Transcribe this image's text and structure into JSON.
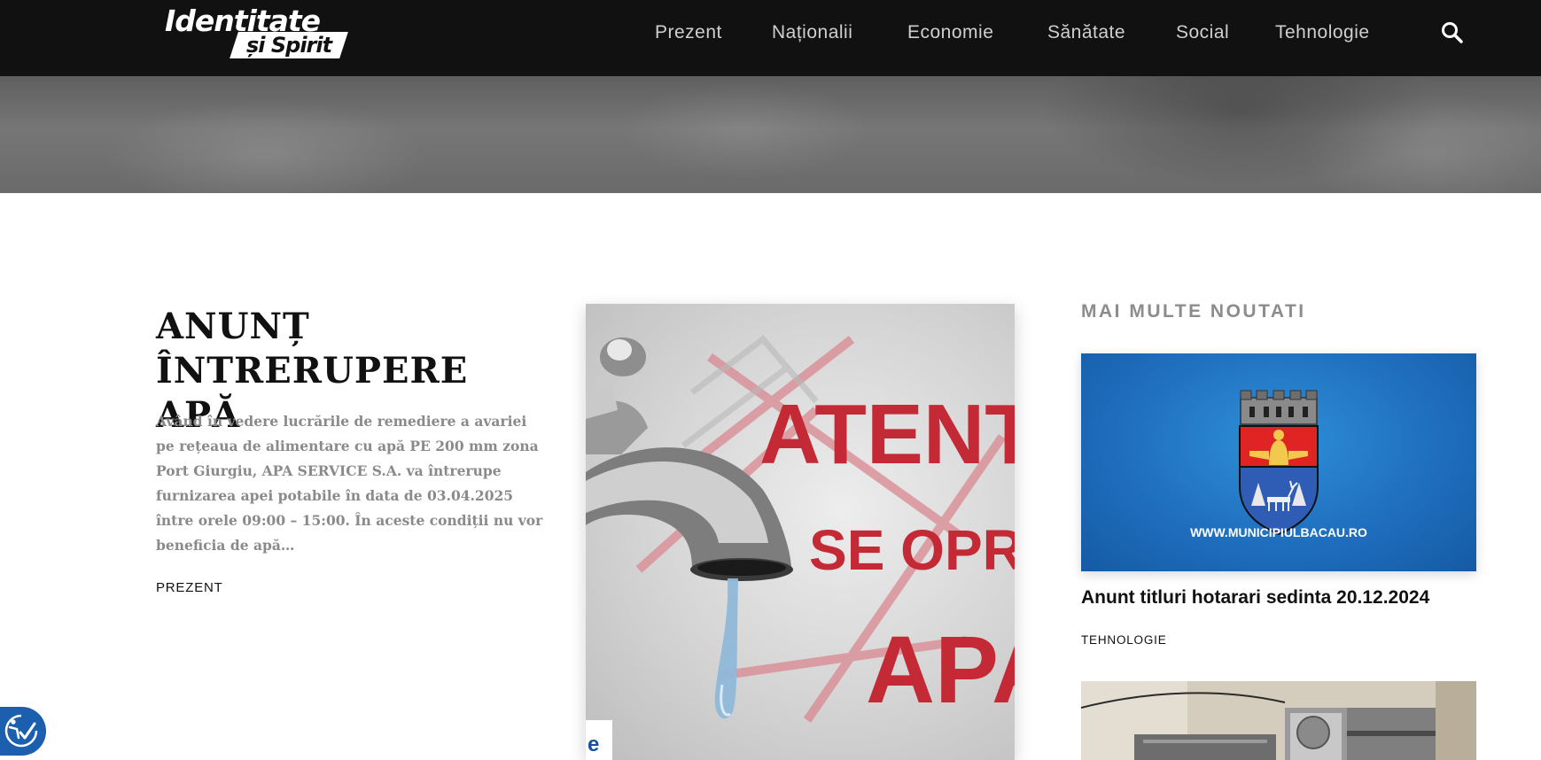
{
  "header": {
    "logo": {
      "line1": "Identitate",
      "line2": "și Spirit"
    },
    "nav": [
      {
        "label": "Prezent"
      },
      {
        "label": "Naționalii"
      },
      {
        "label": "Economie"
      },
      {
        "label": "Sănătate"
      },
      {
        "label": "Social"
      },
      {
        "label": "Tehnologie"
      }
    ],
    "search_icon": "search-icon"
  },
  "article": {
    "title": "ANUNȚ ÎNTRERUPERE APĂ",
    "excerpt": "Având în vedere lucrările de remediere a avariei pe rețeaua de alimentare cu apă PE 200 mm zona Port Giurgiu, APA SERVICE S.A. va întrerupe furnizarea apei potabile în data de 03.04.2025 între orele 09:00 – 15:00. În aceste condiții nu vor beneficia de apă…",
    "category": "PREZENT",
    "image_text": {
      "line1": "ATENT",
      "line2": "SE OPRI",
      "line3": "APA",
      "corner_letter": "e"
    }
  },
  "sidebar": {
    "title": "MAI MULTE NOUTATI",
    "posts": [
      {
        "title": "Anunt titluri hotarari sedinta 20.12.2024",
        "category": "TEHNOLOGIE",
        "image_caption": "WWW.MUNICIPIULBACAU.RO"
      }
    ]
  },
  "accessibility": {
    "icon": "accessibility-icon"
  },
  "colors": {
    "header_bg": "#111111",
    "nav_text": "#cfcfcf",
    "excerpt_text": "#8a8a8a",
    "sidebar_heading": "#8c8c8c",
    "image_red": "#c32a35",
    "bacau_blue": "#1f6fbf",
    "a11y_blue": "#1b5fae"
  }
}
